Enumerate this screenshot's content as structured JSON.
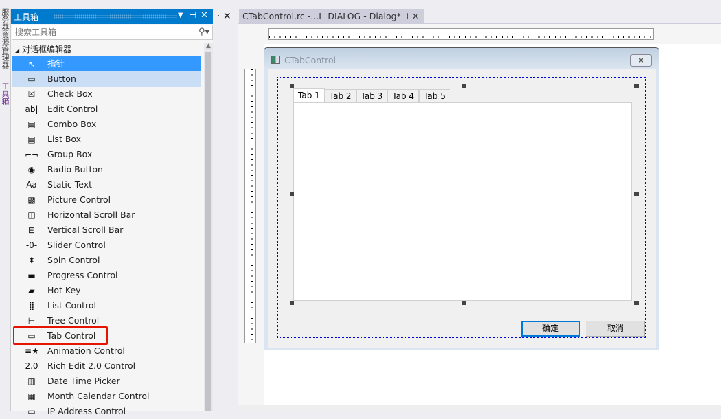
{
  "side_tabs": [
    "服务器资源管理器",
    "工具箱"
  ],
  "toolbox": {
    "title": "工具箱",
    "search_placeholder": "搜索工具箱",
    "section": "对话框编辑器",
    "items": [
      {
        "label": "指针",
        "icon": "pointer-icon",
        "state": "selected"
      },
      {
        "label": "Button",
        "icon": "button-icon",
        "state": "hover"
      },
      {
        "label": "Check Box",
        "icon": "checkbox-icon"
      },
      {
        "label": "Edit Control",
        "icon": "edit-control-icon"
      },
      {
        "label": "Combo Box",
        "icon": "combo-box-icon"
      },
      {
        "label": "List Box",
        "icon": "list-box-icon"
      },
      {
        "label": "Group Box",
        "icon": "group-box-icon"
      },
      {
        "label": "Radio Button",
        "icon": "radio-button-icon"
      },
      {
        "label": "Static Text",
        "icon": "static-text-icon"
      },
      {
        "label": "Picture Control",
        "icon": "picture-control-icon"
      },
      {
        "label": "Horizontal Scroll Bar",
        "icon": "hscroll-icon"
      },
      {
        "label": "Vertical Scroll Bar",
        "icon": "vscroll-icon"
      },
      {
        "label": "Slider Control",
        "icon": "slider-icon"
      },
      {
        "label": "Spin Control",
        "icon": "spin-icon"
      },
      {
        "label": "Progress Control",
        "icon": "progress-icon"
      },
      {
        "label": "Hot Key",
        "icon": "hotkey-icon"
      },
      {
        "label": "List Control",
        "icon": "list-control-icon"
      },
      {
        "label": "Tree Control",
        "icon": "tree-control-icon"
      },
      {
        "label": "Tab Control",
        "icon": "tab-control-icon",
        "highlighted": true
      },
      {
        "label": "Animation Control",
        "icon": "animation-icon"
      },
      {
        "label": "Rich Edit 2.0 Control",
        "icon": "rich-edit-icon"
      },
      {
        "label": "Date Time Picker",
        "icon": "date-time-icon"
      },
      {
        "label": "Month Calendar Control",
        "icon": "calendar-icon"
      },
      {
        "label": "IP Address Control",
        "icon": "ip-address-icon"
      }
    ]
  },
  "document_tab": {
    "title": "CTabControl.rc -...L_DIALOG - Dialog*"
  },
  "dialog": {
    "title": "CTabControl",
    "tabs": [
      "Tab 1",
      "Tab 2",
      "Tab 3",
      "Tab 4",
      "Tab 5"
    ],
    "active_tab": 0,
    "ok_label": "确定",
    "cancel_label": "取消"
  },
  "colors": {
    "accent": "#007acc",
    "selected": "#3399ff",
    "highlight_box": "#e51400"
  }
}
